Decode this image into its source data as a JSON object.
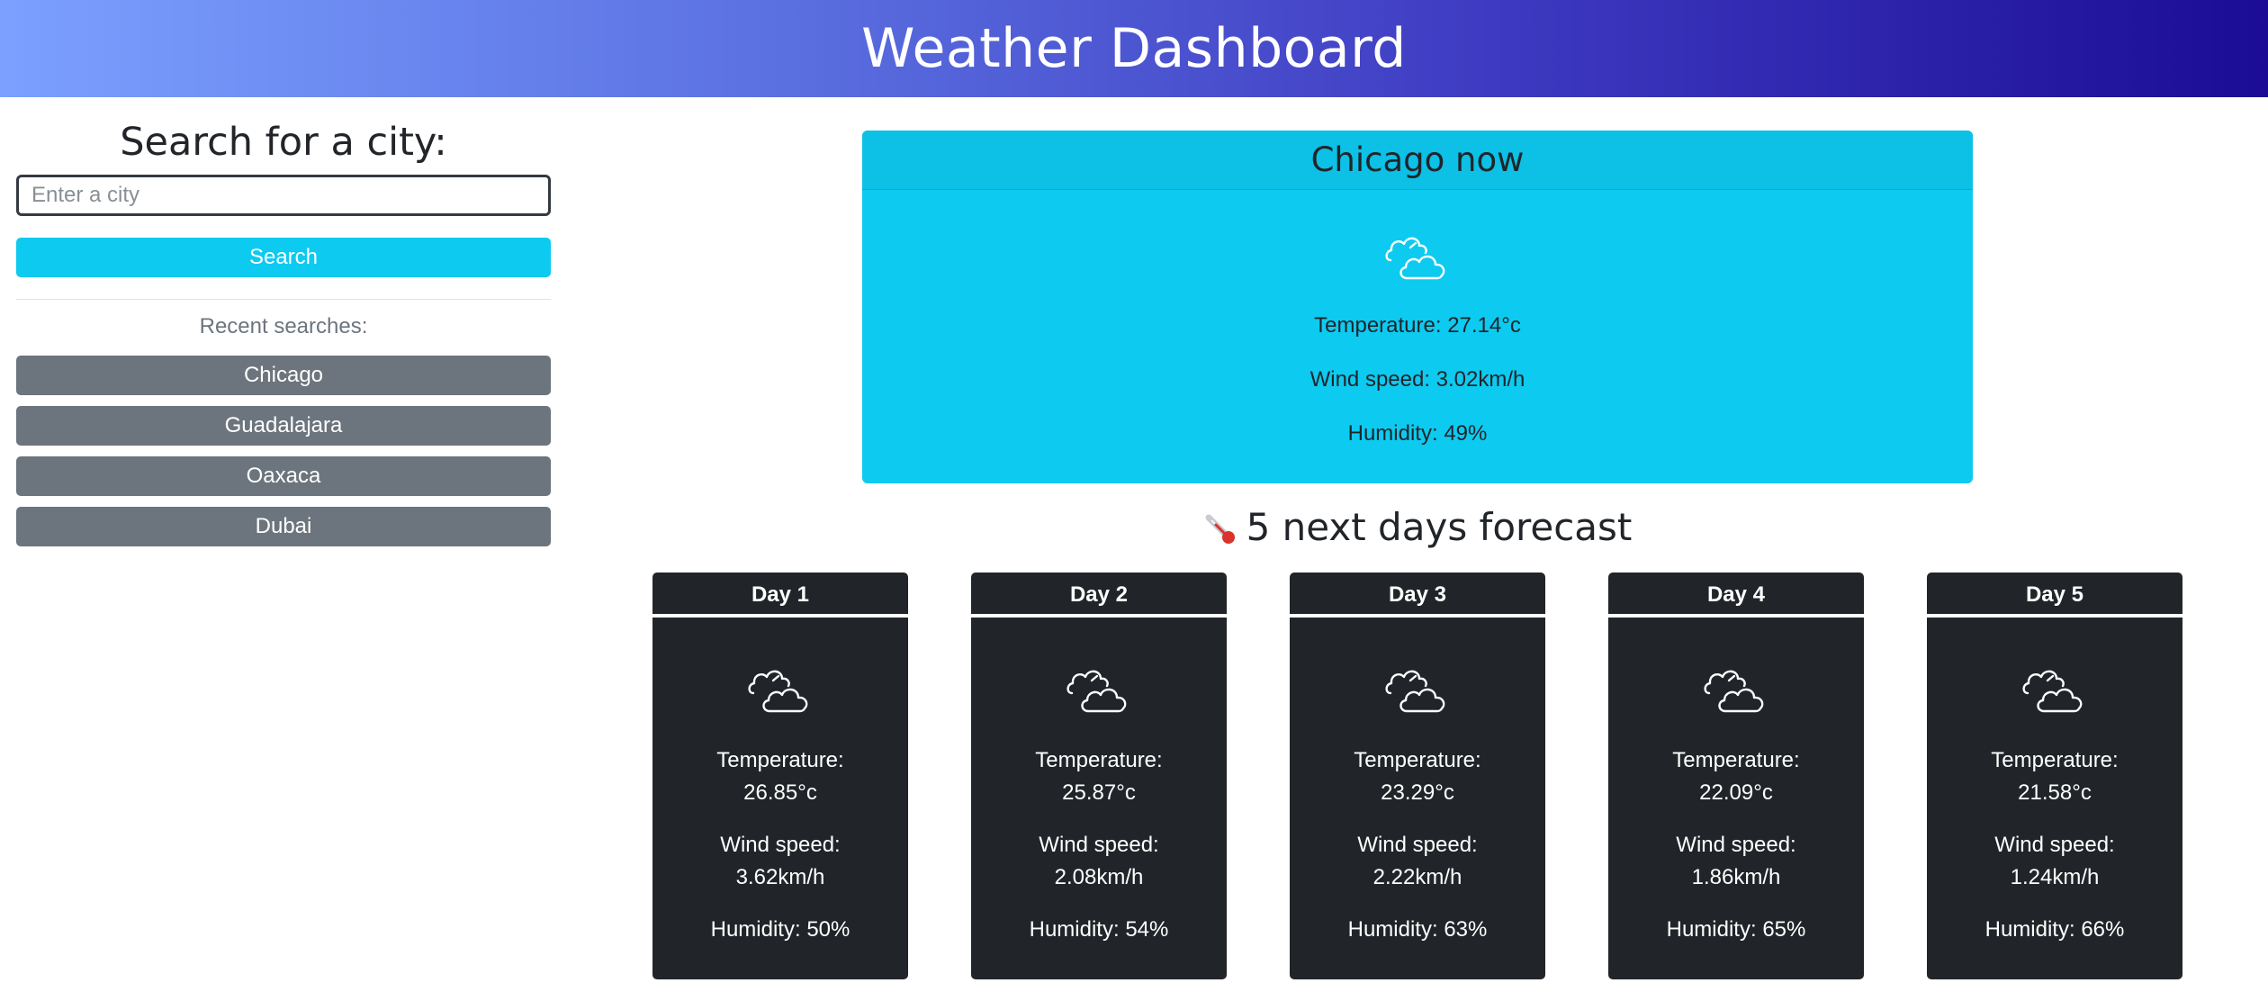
{
  "header": {
    "title": "Weather Dashboard"
  },
  "sidebar": {
    "heading": "Search for a city:",
    "search_placeholder": "Enter a city",
    "search_value": "",
    "search_button": "Search",
    "recent_label": "Recent searches:",
    "recent": [
      "Chicago",
      "Guadalajara",
      "Oaxaca",
      "Dubai"
    ]
  },
  "current": {
    "title": "Chicago now",
    "icon": "cloudy-icon",
    "temperature": "Temperature: 27.14°c",
    "wind": "Wind speed: 3.02km/h",
    "humidity": "Humidity: 49%"
  },
  "forecast": {
    "title": "5 next days forecast",
    "title_icon": "thermometer-icon",
    "temperature_label": "Temperature:",
    "wind_label": "Wind speed:",
    "days": [
      {
        "label": "Day 1",
        "icon": "cloudy-icon",
        "temperature": "26.85°c",
        "wind": "3.62km/h",
        "humidity": "Humidity: 50%"
      },
      {
        "label": "Day 2",
        "icon": "cloudy-icon",
        "temperature": "25.87°c",
        "wind": "2.08km/h",
        "humidity": "Humidity: 54%"
      },
      {
        "label": "Day 3",
        "icon": "cloudy-icon",
        "temperature": "23.29°c",
        "wind": "2.22km/h",
        "humidity": "Humidity: 63%"
      },
      {
        "label": "Day 4",
        "icon": "cloudy-icon",
        "temperature": "22.09°c",
        "wind": "1.86km/h",
        "humidity": "Humidity: 65%"
      },
      {
        "label": "Day 5",
        "icon": "cloudy-icon",
        "temperature": "21.58°c",
        "wind": "1.24km/h",
        "humidity": "Humidity: 66%"
      }
    ]
  },
  "colors": {
    "accent": "#0dcaf0",
    "secondary": "#6c757d",
    "dark_card": "#212529",
    "header_gradient_start": "#7ba0ff",
    "header_gradient_end": "#1b0c95"
  }
}
